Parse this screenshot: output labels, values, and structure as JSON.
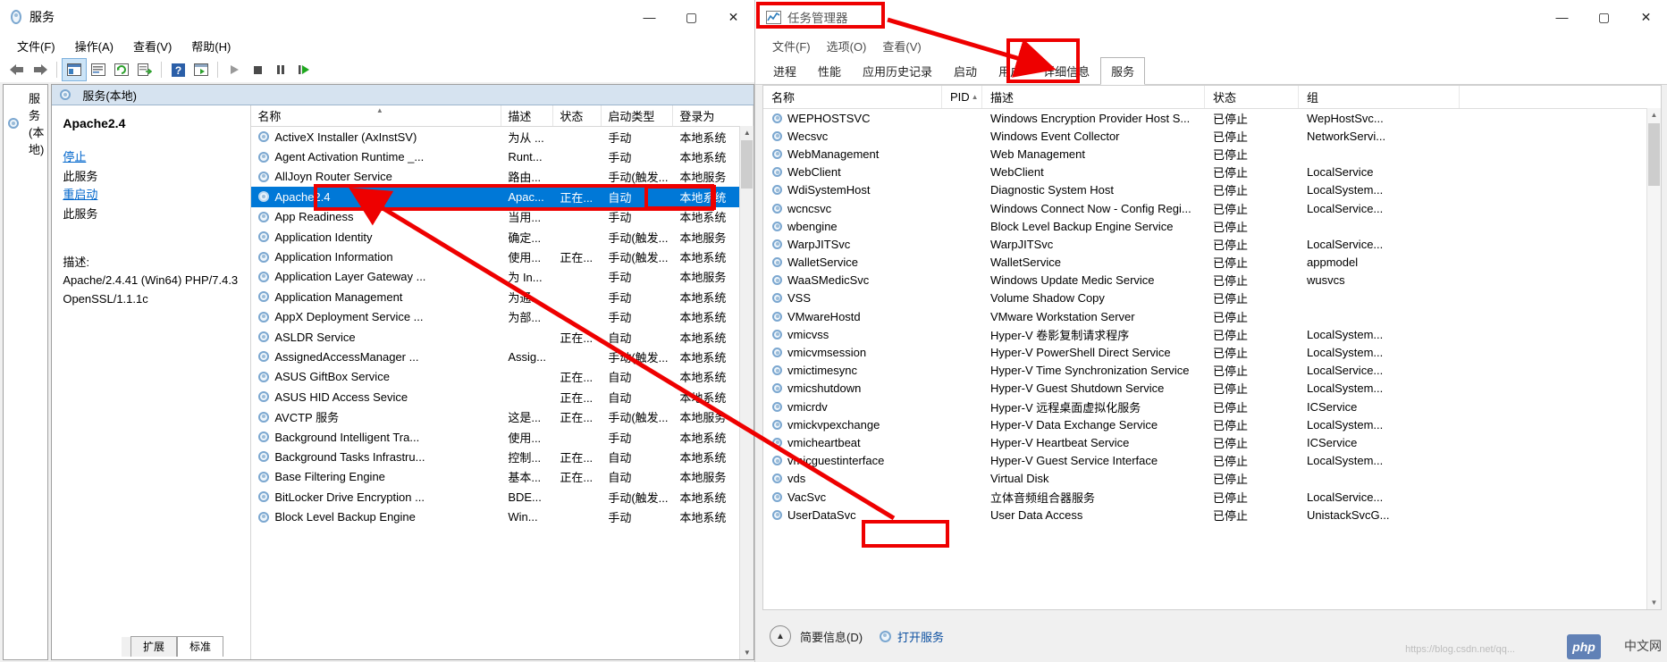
{
  "services_window": {
    "title": "服务",
    "title_icon": "services-gear-icon",
    "window_buttons": {
      "minimize": "—",
      "maximize": "▢",
      "close": "✕"
    },
    "menu": [
      {
        "label": "文件(F)"
      },
      {
        "label": "操作(A)"
      },
      {
        "label": "查看(V)"
      },
      {
        "label": "帮助(H)"
      }
    ],
    "toolbar_icons": [
      "back-arrow-icon",
      "forward-arrow-icon",
      "sep",
      "show-hide-tree-icon",
      "properties-icon",
      "refresh-icon",
      "export-list-icon",
      "sep",
      "help-icon",
      "console-icon",
      "sep",
      "start-service-icon",
      "stop-service-icon",
      "pause-service-icon",
      "restart-service-icon"
    ],
    "tree": {
      "root_label": "服务(本地)",
      "root_icon": "services-gear-icon"
    },
    "pane_header": {
      "label": "服务(本地)",
      "icon": "services-gear-icon"
    },
    "detail": {
      "service_name": "Apache2.4",
      "stop_link_prefix": "停止",
      "stop_link_suffix": "此服务",
      "restart_link_prefix": "重启动",
      "restart_link_suffix": "此服务",
      "desc_label": "描述:",
      "desc_line1": "Apache/2.4.41 (Win64) PHP/7.4.3",
      "desc_line2": "OpenSSL/1.1.1c"
    },
    "columns": [
      "名称",
      "描述",
      "状态",
      "启动类型",
      "登录为"
    ],
    "sorted_column_index": 0,
    "rows": [
      {
        "name": "ActiveX Installer (AxInstSV)",
        "desc": "为从 ...",
        "status": "",
        "startup": "手动",
        "logon": "本地系统"
      },
      {
        "name": "Agent Activation Runtime _...",
        "desc": "Runt...",
        "status": "",
        "startup": "手动",
        "logon": "本地系统"
      },
      {
        "name": "AllJoyn Router Service",
        "desc": "路由...",
        "status": "",
        "startup": "手动(触发...",
        "logon": "本地服务"
      },
      {
        "name": "Apache2.4",
        "desc": "Apac...",
        "status": "正在...",
        "startup": "自动",
        "logon": "本地系统",
        "selected": true
      },
      {
        "name": "App Readiness",
        "desc": "当用...",
        "status": "",
        "startup": "手动",
        "logon": "本地系统"
      },
      {
        "name": "Application Identity",
        "desc": "确定...",
        "status": "",
        "startup": "手动(触发...",
        "logon": "本地服务"
      },
      {
        "name": "Application Information",
        "desc": "使用...",
        "status": "正在...",
        "startup": "手动(触发...",
        "logon": "本地系统"
      },
      {
        "name": "Application Layer Gateway ...",
        "desc": "为 In...",
        "status": "",
        "startup": "手动",
        "logon": "本地服务"
      },
      {
        "name": "Application Management",
        "desc": "为通...",
        "status": "",
        "startup": "手动",
        "logon": "本地系统"
      },
      {
        "name": "AppX Deployment Service ...",
        "desc": "为部...",
        "status": "",
        "startup": "手动",
        "logon": "本地系统"
      },
      {
        "name": "ASLDR Service",
        "desc": "",
        "status": "正在...",
        "startup": "自动",
        "logon": "本地系统"
      },
      {
        "name": "AssignedAccessManager ...",
        "desc": "Assig...",
        "status": "",
        "startup": "手动(触发...",
        "logon": "本地系统"
      },
      {
        "name": "ASUS GiftBox Service",
        "desc": "",
        "status": "正在...",
        "startup": "自动",
        "logon": "本地系统"
      },
      {
        "name": "ASUS HID Access Sevice",
        "desc": "",
        "status": "正在...",
        "startup": "自动",
        "logon": "本地系统"
      },
      {
        "name": "AVCTP 服务",
        "desc": "这是...",
        "status": "正在...",
        "startup": "手动(触发...",
        "logon": "本地服务"
      },
      {
        "name": "Background Intelligent Tra...",
        "desc": "使用...",
        "status": "",
        "startup": "手动",
        "logon": "本地系统"
      },
      {
        "name": "Background Tasks Infrastru...",
        "desc": "控制...",
        "status": "正在...",
        "startup": "自动",
        "logon": "本地系统"
      },
      {
        "name": "Base Filtering Engine",
        "desc": "基本...",
        "status": "正在...",
        "startup": "自动",
        "logon": "本地服务"
      },
      {
        "name": "BitLocker Drive Encryption ...",
        "desc": "BDE...",
        "status": "",
        "startup": "手动(触发...",
        "logon": "本地系统"
      },
      {
        "name": "Block Level Backup Engine ",
        "desc": "Win...",
        "status": "",
        "startup": "手动",
        "logon": "本地系统"
      }
    ],
    "tabs": [
      {
        "label": "扩展",
        "active": false
      },
      {
        "label": "标准",
        "active": true
      }
    ]
  },
  "task_manager": {
    "title": "任务管理器",
    "title_icon": "task-manager-chart-icon",
    "window_buttons": {
      "minimize": "—",
      "maximize": "▢",
      "close": "✕"
    },
    "menu": [
      {
        "label": "文件(F)"
      },
      {
        "label": "选项(O)"
      },
      {
        "label": "查看(V)"
      }
    ],
    "tabs": [
      {
        "label": "进程",
        "active": false
      },
      {
        "label": "性能",
        "active": false
      },
      {
        "label": "应用历史记录",
        "active": false
      },
      {
        "label": "启动",
        "active": false
      },
      {
        "label": "用户",
        "active": false
      },
      {
        "label": "详细信息",
        "active": false
      },
      {
        "label": "服务",
        "active": true
      }
    ],
    "columns": [
      "名称",
      "PID",
      "描述",
      "状态",
      "组"
    ],
    "sorted_column_index": 1,
    "rows": [
      {
        "name": "WEPHOSTSVC",
        "pid": "",
        "desc": "Windows Encryption Provider Host S...",
        "status": "已停止",
        "group": "WepHostSvc..."
      },
      {
        "name": "Wecsvc",
        "pid": "",
        "desc": "Windows Event Collector",
        "status": "已停止",
        "group": "NetworkServi..."
      },
      {
        "name": "WebManagement",
        "pid": "",
        "desc": "Web Management",
        "status": "已停止",
        "group": ""
      },
      {
        "name": "WebClient",
        "pid": "",
        "desc": "WebClient",
        "status": "已停止",
        "group": "LocalService"
      },
      {
        "name": "WdiSystemHost",
        "pid": "",
        "desc": "Diagnostic System Host",
        "status": "已停止",
        "group": "LocalSystem..."
      },
      {
        "name": "wcncsvc",
        "pid": "",
        "desc": "Windows Connect Now - Config Regi...",
        "status": "已停止",
        "group": "LocalService..."
      },
      {
        "name": "wbengine",
        "pid": "",
        "desc": "Block Level Backup Engine Service",
        "status": "已停止",
        "group": ""
      },
      {
        "name": "WarpJITSvc",
        "pid": "",
        "desc": "WarpJITSvc",
        "status": "已停止",
        "group": "LocalService..."
      },
      {
        "name": "WalletService",
        "pid": "",
        "desc": "WalletService",
        "status": "已停止",
        "group": "appmodel"
      },
      {
        "name": "WaaSMedicSvc",
        "pid": "",
        "desc": "Windows Update Medic Service",
        "status": "已停止",
        "group": "wusvcs"
      },
      {
        "name": "VSS",
        "pid": "",
        "desc": "Volume Shadow Copy",
        "status": "已停止",
        "group": ""
      },
      {
        "name": "VMwareHostd",
        "pid": "",
        "desc": "VMware Workstation Server",
        "status": "已停止",
        "group": ""
      },
      {
        "name": "vmicvss",
        "pid": "",
        "desc": "Hyper-V 卷影复制请求程序",
        "status": "已停止",
        "group": "LocalSystem..."
      },
      {
        "name": "vmicvmsession",
        "pid": "",
        "desc": "Hyper-V PowerShell Direct Service",
        "status": "已停止",
        "group": "LocalSystem..."
      },
      {
        "name": "vmictimesync",
        "pid": "",
        "desc": "Hyper-V Time Synchronization Service",
        "status": "已停止",
        "group": "LocalService..."
      },
      {
        "name": "vmicshutdown",
        "pid": "",
        "desc": "Hyper-V Guest Shutdown Service",
        "status": "已停止",
        "group": "LocalSystem..."
      },
      {
        "name": "vmicrdv",
        "pid": "",
        "desc": "Hyper-V 远程桌面虚拟化服务",
        "status": "已停止",
        "group": "ICService"
      },
      {
        "name": "vmickvpexchange",
        "pid": "",
        "desc": "Hyper-V Data Exchange Service",
        "status": "已停止",
        "group": "LocalSystem..."
      },
      {
        "name": "vmicheartbeat",
        "pid": "",
        "desc": "Hyper-V Heartbeat Service",
        "status": "已停止",
        "group": "ICService"
      },
      {
        "name": "vmicguestinterface",
        "pid": "",
        "desc": "Hyper-V Guest Service Interface",
        "status": "已停止",
        "group": "LocalSystem..."
      },
      {
        "name": "vds",
        "pid": "",
        "desc": "Virtual Disk",
        "status": "已停止",
        "group": ""
      },
      {
        "name": "VacSvc",
        "pid": "",
        "desc": "立体音频组合器服务",
        "status": "已停止",
        "group": "LocalService..."
      },
      {
        "name": "UserDataSvc",
        "pid": "",
        "desc": "User Data Access",
        "status": "已停止",
        "group": "UnistackSvcG..."
      }
    ],
    "footer": {
      "collapse_icon": "chevron-up-circle-icon",
      "fewer_details_label": "简要信息(D)",
      "open_services_label": "打开服务",
      "open_services_icon": "services-gear-icon"
    }
  },
  "watermarks": {
    "blog_url": "https://blog.csdn.net/qq...",
    "php_logo": "php",
    "site_label": "中文网"
  },
  "annotations": {
    "color": "#ee0000",
    "boxes": [
      {
        "name": "apache-row-highlight"
      },
      {
        "name": "task-manager-title-highlight"
      },
      {
        "name": "services-tab-highlight"
      },
      {
        "name": "open-services-highlight"
      },
      {
        "name": "localsystem-value-highlight"
      }
    ],
    "arrows": [
      {
        "name": "arrow-tm-title-to-services-tab"
      },
      {
        "name": "arrow-open-services-to-apache-row"
      }
    ]
  }
}
